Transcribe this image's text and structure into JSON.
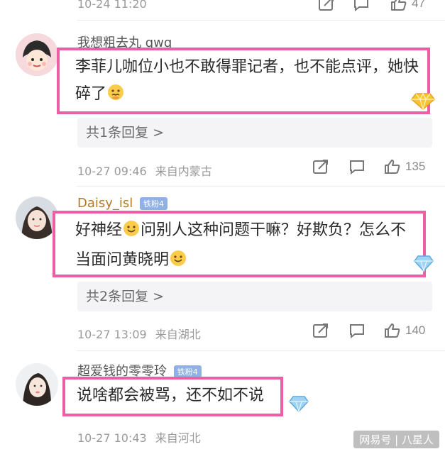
{
  "top_item": {
    "time": "10-24 11:20",
    "like_count": "47"
  },
  "comments": [
    {
      "username": "我想粗去丸 qwq",
      "badge": "",
      "text": "李菲儿咖位小也不敢得罪记者，也不能点评，她快碎了",
      "replies_label": "共1条回复 >",
      "time": "10-27 09:46",
      "location": "来自内蒙古",
      "like_count": "135"
    },
    {
      "username": "Daisy_isl",
      "badge": "铁粉4",
      "text_part1": "好神经",
      "text_part2": "问别人这种问题干嘛？好欺负？怎么不当面问黄晓明",
      "replies_label": "共2条回复 >",
      "time": "10-27 13:09",
      "location": "来自湖北",
      "like_count": "140"
    },
    {
      "username": "超爱钱的零零玲",
      "badge": "铁粉4",
      "text": "说啥都会被骂，还不如不说",
      "time": "10-27 10:43",
      "location": "来自河北"
    }
  ],
  "watermark": "网易号 | 八星人",
  "icons": [
    "share-icon",
    "comment-icon",
    "like-icon",
    "emoji-face-icon",
    "smile-icon",
    "diamond-sticker-icon"
  ],
  "colors": {
    "highlight_border": "#ec5fa5",
    "badge_bg": "#8fb1e6",
    "meta_text": "#9a9a9a"
  }
}
